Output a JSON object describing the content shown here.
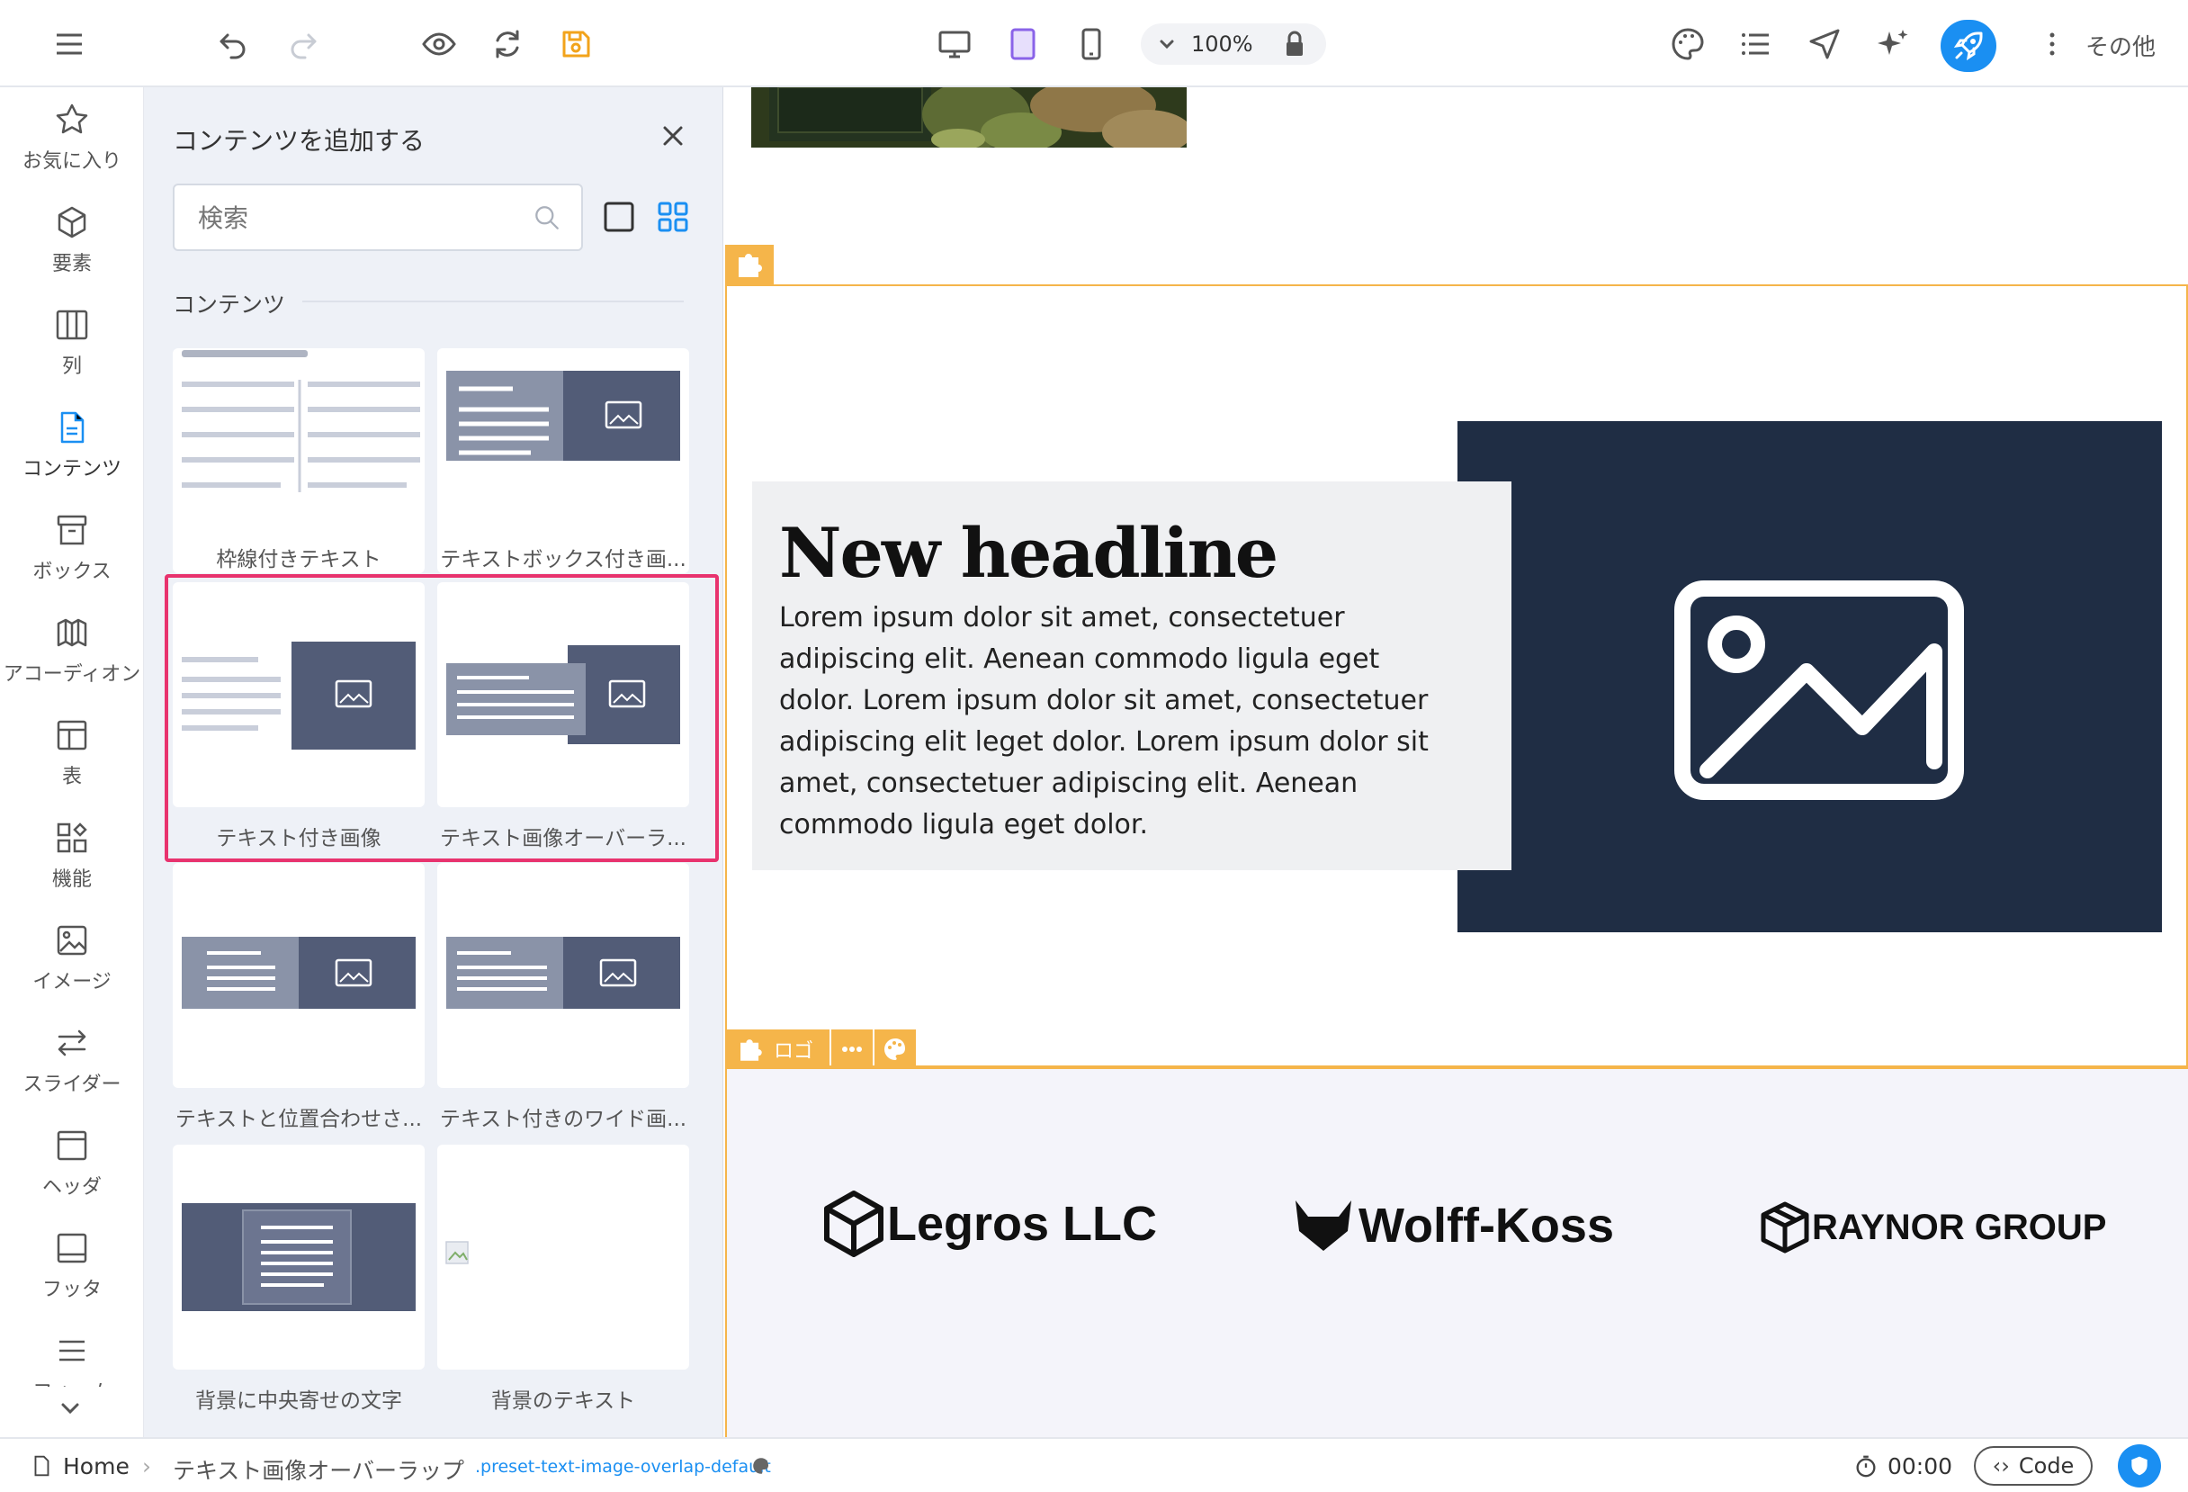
{
  "toolbar": {
    "zoom": "100%",
    "more_label": "その他"
  },
  "sidebar": {
    "items": [
      {
        "label": "お気に入り",
        "icon": "star-icon"
      },
      {
        "label": "要素",
        "icon": "cube-icon"
      },
      {
        "label": "列",
        "icon": "columns-icon"
      },
      {
        "label": "コンテンツ",
        "icon": "document-icon"
      },
      {
        "label": "ボックス",
        "icon": "box-icon"
      },
      {
        "label": "アコーディオン",
        "icon": "accordion-icon"
      },
      {
        "label": "表",
        "icon": "table-icon"
      },
      {
        "label": "機能",
        "icon": "features-icon"
      },
      {
        "label": "イメージ",
        "icon": "image-icon"
      },
      {
        "label": "スライダー",
        "icon": "slider-icon"
      },
      {
        "label": "ヘッダ",
        "icon": "header-icon"
      },
      {
        "label": "フッタ",
        "icon": "footer-icon"
      },
      {
        "label": "フォーム",
        "icon": "form-icon"
      }
    ],
    "active_index": 3
  },
  "panel": {
    "title": "コンテンツを追加する",
    "search_placeholder": "検索",
    "section": "コンテンツ",
    "cards": [
      {
        "label": "枠線付きテキスト"
      },
      {
        "label": "テキストボックス付き画..."
      },
      {
        "label": "テキスト付き画像"
      },
      {
        "label": "テキスト画像オーバーラ..."
      },
      {
        "label": "テキストと位置合わせさ..."
      },
      {
        "label": "テキスト付きのワイド画..."
      },
      {
        "label": "背景に中央寄せの文字"
      },
      {
        "label": "背景のテキスト"
      }
    ]
  },
  "canvas": {
    "headline": "New headline",
    "body": "Lorem ipsum dolor sit amet, consectetuer adipiscing elit. Aenean commodo ligula eget dolor. Lorem ipsum dolor sit amet, consectetuer adipiscing elit leget dolor. Lorem ipsum dolor sit amet, consectetuer adipiscing elit. Aenean commodo ligula eget dolor.",
    "section_tag": "ロゴ",
    "logos": [
      "Legros LLC",
      "Wolff-Koss",
      "RAYNOR GROUP"
    ]
  },
  "statusbar": {
    "home": "Home",
    "current": "テキスト画像オーバーラップ",
    "preset": ".preset-text-image-overlap-default",
    "timer": "00:00",
    "code": "Code"
  },
  "colors": {
    "accent": "#1a8ff2",
    "selection": "#f5b54a",
    "highlight": "#e8336e",
    "navy": "#1f2d44"
  }
}
